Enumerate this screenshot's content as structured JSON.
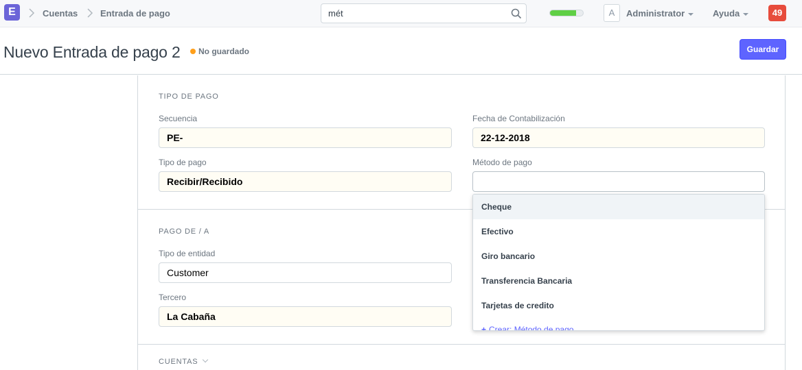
{
  "navbar": {
    "logo_letter": "E",
    "breadcrumbs": [
      "Cuentas",
      "Entrada de pago"
    ],
    "search_value": "mét",
    "progress": 0.8,
    "avatar_letter": "A",
    "user": "Administrator",
    "help": "Ayuda",
    "notifications": "49"
  },
  "page": {
    "title": "Nuevo Entrada de pago 2",
    "status": "No guardado",
    "save_label": "Guardar"
  },
  "sections": {
    "tipo_pago": {
      "label": "TIPO DE PAGO",
      "secuencia_label": "Secuencia",
      "secuencia_value": "PE-",
      "fecha_label": "Fecha de Contabilización",
      "fecha_value": "22-12-2018",
      "tipo_label": "Tipo de pago",
      "tipo_value": "Recibir/Recibido",
      "metodo_label": "Método de pago",
      "metodo_value": ""
    },
    "pago_de": {
      "label": "PAGO DE / A",
      "entidad_label": "Tipo de entidad",
      "entidad_value": "Customer",
      "tercero_label": "Tercero",
      "tercero_value": "La Cabaña"
    },
    "cuentas": {
      "label": "CUENTAS"
    }
  },
  "dropdown": {
    "items": [
      "Cheque",
      "Efectivo",
      "Giro bancario",
      "Transferencia Bancaria",
      "Tarjetas de credito"
    ],
    "create_label": "Crear: Método de pago"
  },
  "colors": {
    "primary": "#5e64ff",
    "notification": "#e74c3c",
    "unsaved_dot": "#ff9f1a",
    "progress": "#5fcf45"
  }
}
